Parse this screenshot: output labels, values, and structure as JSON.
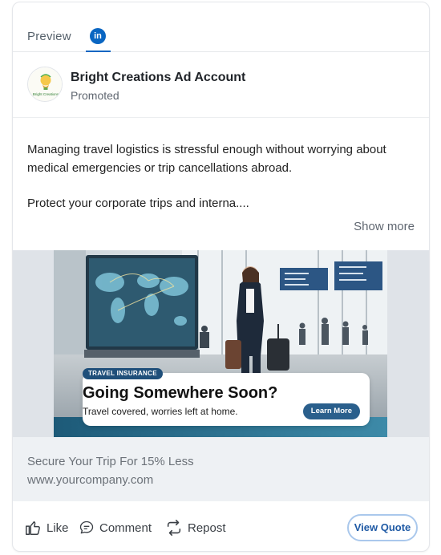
{
  "tabs": {
    "preview_label": "Preview",
    "linkedin_icon_text": "in"
  },
  "post": {
    "account_name": "Bright Creations Ad Account",
    "promoted_label": "Promoted",
    "avatar_text": "Bright Creations",
    "body_line1": "Managing travel logistics is stressful enough without worrying about medical emergencies or trip cancellations abroad.",
    "body_line2": "Protect your corporate trips and interna....",
    "show_more": "Show more"
  },
  "ad_image": {
    "tag": "TRAVEL INSURANCE",
    "headline": "Going Somewhere Soon?",
    "subline": "Travel covered, worries left at home.",
    "button": "Learn More"
  },
  "link": {
    "title": "Secure Your Trip For 15% Less",
    "url": "www.yourcompany.com"
  },
  "actions": {
    "like": "Like",
    "comment": "Comment",
    "repost": "Repost",
    "cta": "View Quote"
  },
  "colors": {
    "linkedin_blue": "#0a66c2",
    "cta_text": "#1f5aa5",
    "cta_border": "#aac8ec"
  }
}
